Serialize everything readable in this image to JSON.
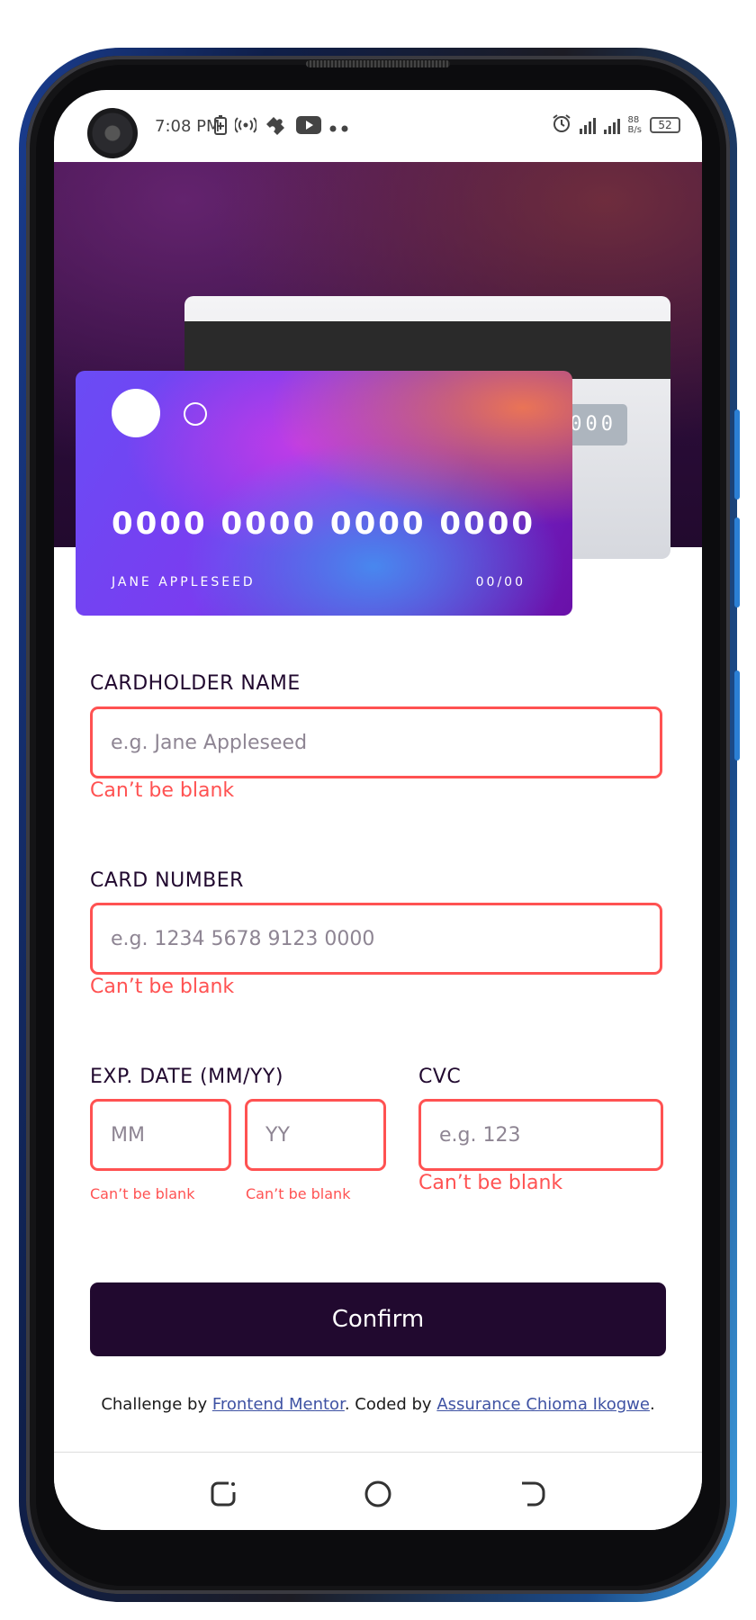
{
  "status_bar": {
    "time": "7:08 PM",
    "data_speed": "88\nB/s",
    "battery": "52"
  },
  "card_back": {
    "cvc": "000"
  },
  "card_front": {
    "number": "0000 0000 0000 0000",
    "name": "JANE APPLESEED",
    "expiry": "00/00"
  },
  "form": {
    "cardholder": {
      "label": "CARDHOLDER NAME",
      "placeholder": "e.g. Jane Appleseed",
      "error": "Can’t be blank"
    },
    "card_number": {
      "label": "CARD NUMBER",
      "placeholder": "e.g. 1234 5678 9123 0000",
      "error": "Can’t be blank"
    },
    "expiry": {
      "label": "EXP. DATE (MM/YY)",
      "mm_placeholder": "MM",
      "yy_placeholder": "YY",
      "mm_error": "Can’t be blank",
      "yy_error": "Can’t be blank"
    },
    "cvc": {
      "label": "CVC",
      "placeholder": "e.g. 123",
      "error": "Can’t be blank"
    },
    "confirm_label": "Confirm"
  },
  "attribution": {
    "prefix": "Challenge by ",
    "link1": "Frontend Mentor",
    "middle": ". Coded by ",
    "link2": "Assurance Chioma Ikogwe",
    "suffix": "."
  },
  "colors": {
    "error": "#ff5252",
    "dark": "#21092f"
  }
}
